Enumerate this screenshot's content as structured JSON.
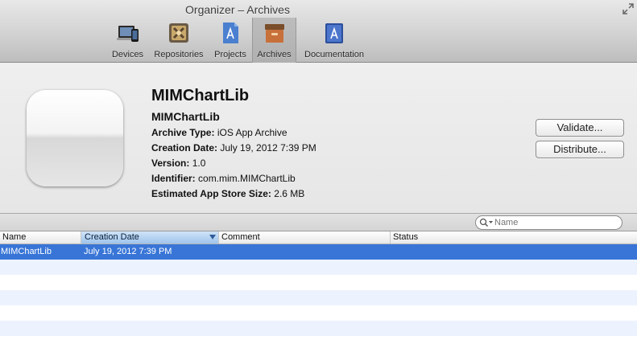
{
  "window": {
    "title": "Organizer – Archives"
  },
  "toolbar": {
    "items": [
      {
        "label": "Devices",
        "icon": "devices-icon"
      },
      {
        "label": "Repositories",
        "icon": "repositories-icon"
      },
      {
        "label": "Projects",
        "icon": "projects-icon"
      },
      {
        "label": "Archives",
        "icon": "archives-icon",
        "active": true
      },
      {
        "label": "Documentation",
        "icon": "documentation-icon"
      }
    ]
  },
  "detail": {
    "title": "MIMChartLib",
    "subtitle": "MIMChartLib",
    "fields": [
      {
        "key": "Archive Type:",
        "value": "iOS App Archive"
      },
      {
        "key": "Creation Date:",
        "value": "July 19, 2012 7:39 PM"
      },
      {
        "key": "Version:",
        "value": "1.0"
      },
      {
        "key": "Identifier:",
        "value": "com.mim.MIMChartLib"
      },
      {
        "key": "Estimated App Store Size:",
        "value": "2.6 MB"
      }
    ],
    "validate_label": "Validate...",
    "distribute_label": "Distribute..."
  },
  "search": {
    "placeholder": "Name",
    "value": ""
  },
  "table": {
    "columns": [
      "Name",
      "Creation Date",
      "Comment",
      "Status"
    ],
    "sorted_column": "Creation Date",
    "rows": [
      {
        "name": "MIMChartLib",
        "creation_date": "July 19, 2012 7:39 PM",
        "comment": "",
        "status": "",
        "selected": true
      }
    ]
  },
  "colors": {
    "selection": "#3875d7",
    "alt_row": "#edf3fe",
    "sorted_header": "#9fc4ec"
  }
}
